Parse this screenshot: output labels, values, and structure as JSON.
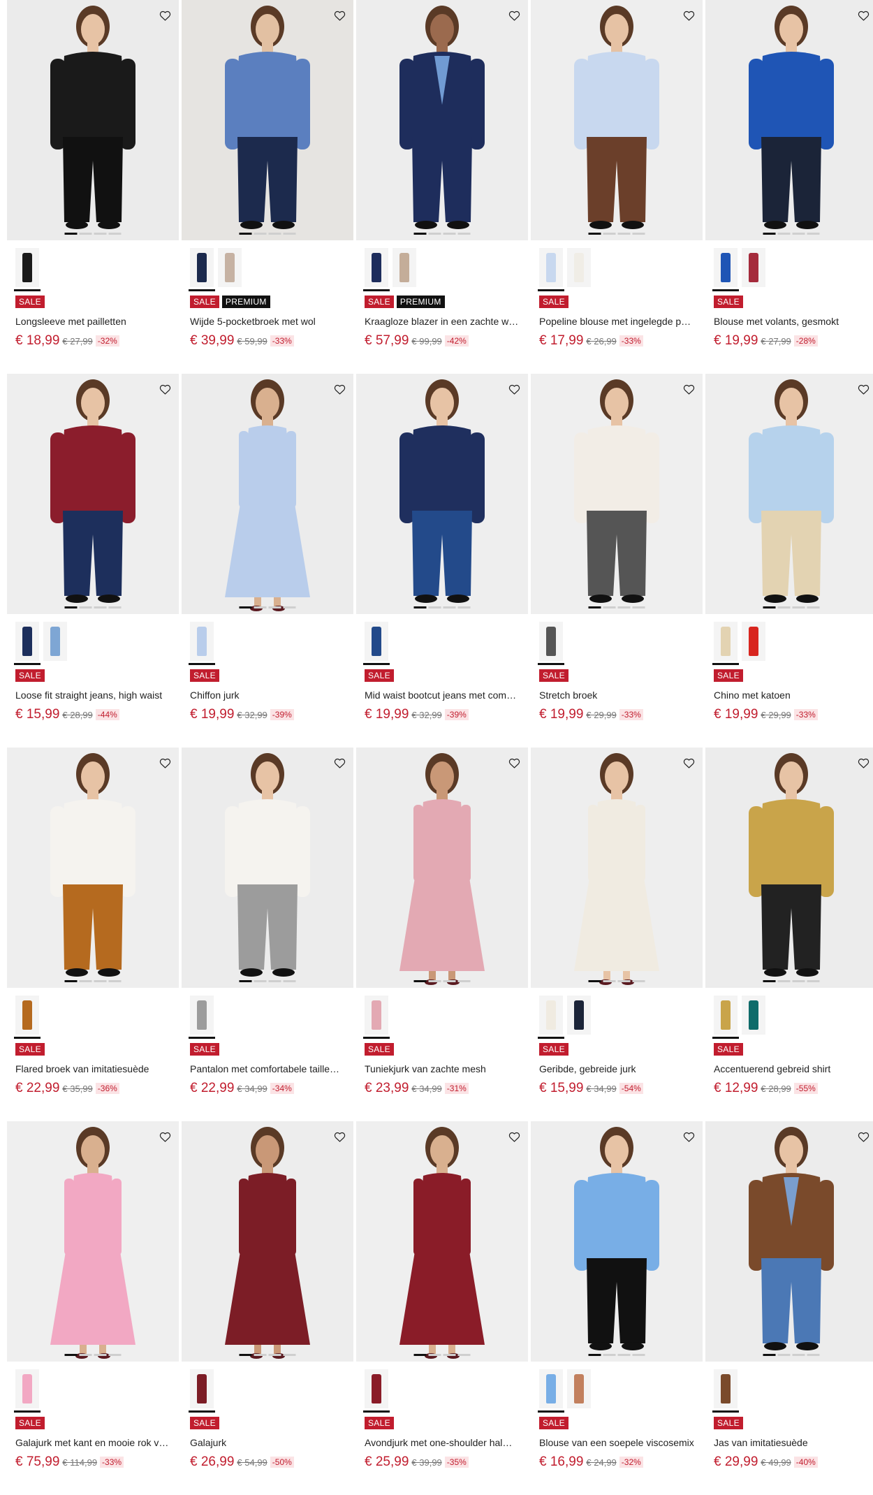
{
  "currency": "€",
  "products": [
    {
      "name": "Longsleeve met pailletten",
      "price": "18,99",
      "old": "27,99",
      "pct": "-32%",
      "badges": [
        "SALE"
      ],
      "bg": "#ebebeb",
      "garment": "#1a1a1a",
      "bottom": "#111111",
      "skin": "#e7c3a5",
      "swatches": [
        "#1a1a1a"
      ],
      "image_icon": "top-photo"
    },
    {
      "name": "Wijde 5-pocketbroek met wol",
      "price": "39,99",
      "old": "59,99",
      "pct": "-33%",
      "badges": [
        "SALE",
        "PREMIUM"
      ],
      "bg": "#e6e4e1",
      "garment": "#5b7fbf",
      "bottom": "#1c2a4d",
      "skin": "#e2c0a2",
      "swatches": [
        "#1c2a4d",
        "#c6b2a3"
      ],
      "image_icon": "trousers-photo"
    },
    {
      "name": "Kraagloze blazer in een zachte w…",
      "price": "57,99",
      "old": "99,99",
      "pct": "-42%",
      "badges": [
        "SALE",
        "PREMIUM"
      ],
      "bg": "#ededed",
      "garment": "#1e2d5c",
      "bottom": "#1e2d5c",
      "skin": "#9b6a4e",
      "swatches": [
        "#1e2d5c",
        "#c4ad99"
      ],
      "image_icon": "blazer-photo"
    },
    {
      "name": "Popeline blouse met ingelegde p…",
      "price": "17,99",
      "old": "26,99",
      "pct": "-33%",
      "badges": [
        "SALE"
      ],
      "bg": "#eeeeee",
      "garment": "#c8d8ef",
      "bottom": "#6b3f2a",
      "skin": "#e6c2a4",
      "swatches": [
        "#c8d8ef",
        "#f0ede6"
      ],
      "image_icon": "blouse-photo"
    },
    {
      "name": "Blouse met volants, gesmokt",
      "price": "19,99",
      "old": "27,99",
      "pct": "-28%",
      "badges": [
        "SALE"
      ],
      "bg": "#ececec",
      "garment": "#1f55b5",
      "bottom": "#1b2438",
      "skin": "#e7c3a5",
      "swatches": [
        "#1f55b5",
        "#a52b3c"
      ],
      "image_icon": "blouse-photo"
    },
    {
      "name": "Loose fit straight jeans, high waist",
      "price": "15,99",
      "old": "28,99",
      "pct": "-44%",
      "badges": [
        "SALE"
      ],
      "bg": "#eeeeee",
      "garment": "#8b1d2c",
      "bottom": "#1d2f5c",
      "skin": "#e7c3a5",
      "swatches": [
        "#1d2f5c",
        "#7ea6d4"
      ],
      "image_icon": "jeans-photo"
    },
    {
      "name": "Chiffon jurk",
      "price": "19,99",
      "old": "32,99",
      "pct": "-39%",
      "badges": [
        "SALE"
      ],
      "bg": "#ececec",
      "garment": "#b9cdeb",
      "bottom": "#b9cdeb",
      "skin": "#d9b08f",
      "swatches": [
        "#b9cdeb"
      ],
      "image_icon": "dress-photo"
    },
    {
      "name": "Mid waist bootcut jeans met com…",
      "price": "19,99",
      "old": "32,99",
      "pct": "-39%",
      "badges": [
        "SALE"
      ],
      "bg": "#eeeeee",
      "garment": "#1f2f5e",
      "bottom": "#234a8a",
      "skin": "#e7c3a5",
      "swatches": [
        "#234a8a"
      ],
      "image_icon": "jeans-photo"
    },
    {
      "name": "Stretch broek",
      "price": "19,99",
      "old": "29,99",
      "pct": "-33%",
      "badges": [
        "SALE"
      ],
      "bg": "#efefef",
      "garment": "#f2ede6",
      "bottom": "#555555",
      "skin": "#e7c3a5",
      "swatches": [
        "#555555"
      ],
      "image_icon": "trousers-photo"
    },
    {
      "name": "Chino met katoen",
      "price": "19,99",
      "old": "29,99",
      "pct": "-33%",
      "badges": [
        "SALE"
      ],
      "bg": "#eeeeee",
      "garment": "#b6d2ec",
      "bottom": "#e3d3b2",
      "skin": "#e7c3a5",
      "swatches": [
        "#e3d3b2",
        "#d8261f"
      ],
      "image_icon": "trousers-photo"
    },
    {
      "name": "Flared broek van imitatiesuède",
      "price": "22,99",
      "old": "35,99",
      "pct": "-36%",
      "badges": [
        "SALE"
      ],
      "bg": "#eeeeee",
      "garment": "#f5f3ef",
      "bottom": "#b56a1f",
      "skin": "#e7c3a5",
      "swatches": [
        "#b56a1f"
      ],
      "image_icon": "trousers-photo"
    },
    {
      "name": "Pantalon met comfortabele taille…",
      "price": "22,99",
      "old": "34,99",
      "pct": "-34%",
      "badges": [
        "SALE"
      ],
      "bg": "#ececec",
      "garment": "#f5f3ef",
      "bottom": "#9c9c9c",
      "skin": "#e7c3a5",
      "swatches": [
        "#9c9c9c"
      ],
      "image_icon": "trousers-photo"
    },
    {
      "name": "Tuniekjurk van zachte mesh",
      "price": "23,99",
      "old": "34,99",
      "pct": "-31%",
      "badges": [
        "SALE"
      ],
      "bg": "#ededed",
      "garment": "#e3a9b3",
      "bottom": "#e3a9b3",
      "skin": "#c99877",
      "swatches": [
        "#e3a9b3"
      ],
      "image_icon": "dress-photo"
    },
    {
      "name": "Geribde, gebreide jurk",
      "price": "15,99",
      "old": "34,99",
      "pct": "-54%",
      "badges": [
        "SALE"
      ],
      "bg": "#eeeeee",
      "garment": "#f0ebe1",
      "bottom": "#f0ebe1",
      "skin": "#e7c3a5",
      "swatches": [
        "#f0ebe1",
        "#1b2438"
      ],
      "image_icon": "dress-photo"
    },
    {
      "name": "Accentuerend gebreid shirt",
      "price": "12,99",
      "old": "28,99",
      "pct": "-55%",
      "badges": [
        "SALE"
      ],
      "bg": "#ececec",
      "garment": "#c9a44a",
      "bottom": "#222222",
      "skin": "#e7c3a5",
      "swatches": [
        "#c9a44a",
        "#0f6b6a"
      ],
      "image_icon": "top-photo"
    },
    {
      "name": "Galajurk met kant en mooie rok v…",
      "price": "75,99",
      "old": "114,99",
      "pct": "-33%",
      "badges": [
        "SALE"
      ],
      "bg": "#efefef",
      "garment": "#f2a8c3",
      "bottom": "#f2a8c3",
      "skin": "#d9b08f",
      "swatches": [
        "#f2a8c3"
      ],
      "image_icon": "dress-photo"
    },
    {
      "name": "Galajurk",
      "price": "26,99",
      "old": "54,99",
      "pct": "-50%",
      "badges": [
        "SALE"
      ],
      "bg": "#ededed",
      "garment": "#7c1d26",
      "bottom": "#7c1d26",
      "skin": "#c99877",
      "swatches": [
        "#7c1d26"
      ],
      "image_icon": "dress-photo"
    },
    {
      "name": "Avondjurk met one-shoulder hal…",
      "price": "25,99",
      "old": "39,99",
      "pct": "-35%",
      "badges": [
        "SALE"
      ],
      "bg": "#efefef",
      "garment": "#8a1c28",
      "bottom": "#8a1c28",
      "skin": "#d9b08f",
      "swatches": [
        "#8a1c28"
      ],
      "image_icon": "dress-photo"
    },
    {
      "name": "Blouse van een soepele viscosemix",
      "price": "16,99",
      "old": "24,99",
      "pct": "-32%",
      "badges": [
        "SALE"
      ],
      "bg": "#eeeeee",
      "garment": "#78aee6",
      "bottom": "#111111",
      "skin": "#e7c3a5",
      "swatches": [
        "#78aee6",
        "#c2805e"
      ],
      "image_icon": "blouse-photo"
    },
    {
      "name": "Jas van imitatiesuède",
      "price": "29,99",
      "old": "49,99",
      "pct": "-40%",
      "badges": [
        "SALE"
      ],
      "bg": "#ececec",
      "garment": "#7a4a2b",
      "bottom": "#4b78b5",
      "skin": "#e7c3a5",
      "swatches": [
        "#7a4a2b"
      ],
      "image_icon": "jacket-photo"
    }
  ]
}
